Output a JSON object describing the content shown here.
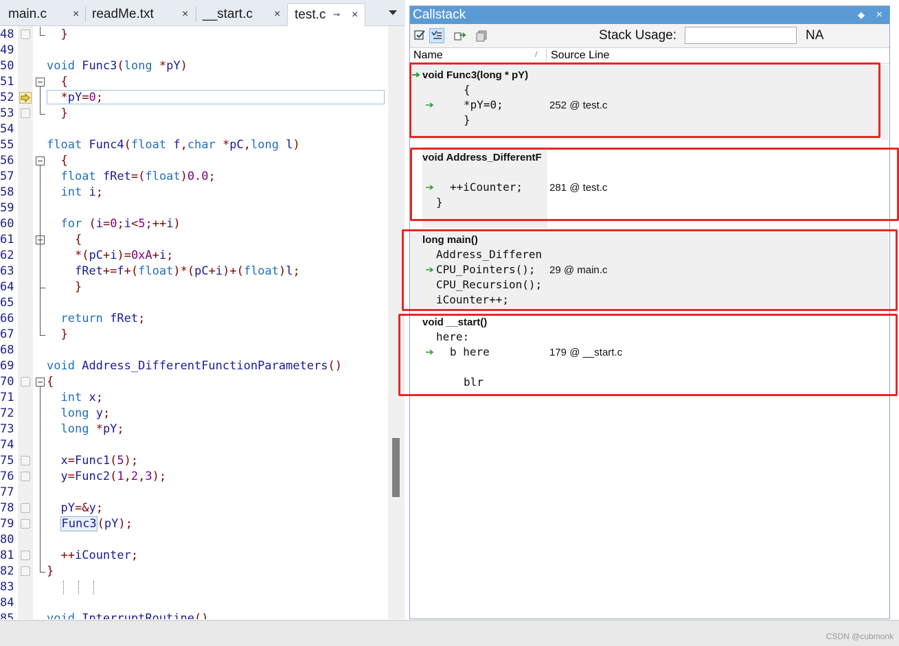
{
  "tabs": [
    {
      "label": "main.c",
      "close": "×"
    },
    {
      "label": "readMe.txt",
      "close": "×"
    },
    {
      "label": "__start.c",
      "close": "×"
    },
    {
      "label": "test.c",
      "close": "×",
      "pin": "⊸"
    }
  ],
  "editor": {
    "lines": [
      {
        "n": "48",
        "t": "  }"
      },
      {
        "n": "49",
        "t": ""
      },
      {
        "n": "50",
        "t": "void Func3(long *pY)"
      },
      {
        "n": "51",
        "t": "  {"
      },
      {
        "n": "52",
        "t": "  *pY=0;"
      },
      {
        "n": "53",
        "t": "  }"
      },
      {
        "n": "54",
        "t": ""
      },
      {
        "n": "55",
        "t": "float Func4(float f,char *pC,long l)"
      },
      {
        "n": "56",
        "t": "  {"
      },
      {
        "n": "57",
        "t": "  float fRet=(float)0.0;"
      },
      {
        "n": "58",
        "t": "  int i;"
      },
      {
        "n": "59",
        "t": ""
      },
      {
        "n": "60",
        "t": "  for (i=0;i<5;++i)"
      },
      {
        "n": "61",
        "t": "    {"
      },
      {
        "n": "62",
        "t": "    *(pC+i)=0xA+i;"
      },
      {
        "n": "63",
        "t": "    fRet+=f+(float)*(pC+i)+(float)l;"
      },
      {
        "n": "64",
        "t": "    }"
      },
      {
        "n": "65",
        "t": ""
      },
      {
        "n": "66",
        "t": "  return fRet;"
      },
      {
        "n": "67",
        "t": "  }"
      },
      {
        "n": "68",
        "t": ""
      },
      {
        "n": "69",
        "t": "void Address_DifferentFunctionParameters()"
      },
      {
        "n": "70",
        "t": "{"
      },
      {
        "n": "71",
        "t": "  int x;"
      },
      {
        "n": "72",
        "t": "  long y;"
      },
      {
        "n": "73",
        "t": "  long *pY;"
      },
      {
        "n": "74",
        "t": ""
      },
      {
        "n": "75",
        "t": "  x=Func1(5);"
      },
      {
        "n": "76",
        "t": "  y=Func2(1,2,3);"
      },
      {
        "n": "77",
        "t": ""
      },
      {
        "n": "78",
        "t": "  pY=&y;"
      },
      {
        "n": "79",
        "t": "  Func3(pY);"
      },
      {
        "n": "80",
        "t": ""
      },
      {
        "n": "81",
        "t": "  ++iCounter;"
      },
      {
        "n": "82",
        "t": "}"
      },
      {
        "n": "83",
        "t": ""
      },
      {
        "n": "84",
        "t": ""
      },
      {
        "n": "85",
        "t": "void InterruptRoutine()"
      }
    ]
  },
  "callstack": {
    "title": "Callstack",
    "pin": "◆",
    "close": "×",
    "stack_usage_label": "Stack Usage:",
    "stack_usage_value": "",
    "na": "NA",
    "col_name": "Name",
    "col_sort": "/",
    "col_source": "Source Line",
    "frames": [
      {
        "head": "void Func3(long * pY)",
        "code": [
          "{",
          "*pY=0;",
          "}"
        ],
        "source": "252 @ test.c"
      },
      {
        "head": "void Address_DifferentF",
        "code": [
          "++iCounter;",
          "}"
        ],
        "source": "281 @ test.c"
      },
      {
        "head": "long main()",
        "code": [
          "Address_Differen",
          "CPU_Pointers();",
          "CPU_Recursion();",
          "iCounter++;"
        ],
        "source": "29 @ main.c"
      },
      {
        "head": "void __start()",
        "code": [
          "here:",
          "b here",
          "blr"
        ],
        "source": "179 @ __start.c"
      }
    ]
  },
  "watermark": "CSDN @cubmonk",
  "colors": {
    "title_bar": "#5b9bd5",
    "annotation_box": "#e52828",
    "keyword": "#1f6fbf",
    "number": "#800080",
    "operator": "#800000"
  }
}
